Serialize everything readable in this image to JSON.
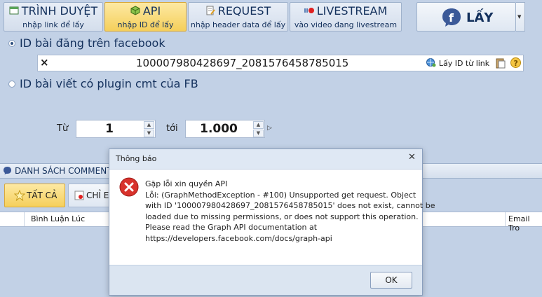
{
  "tabs": [
    {
      "title": "TRÌNH DUYỆT",
      "subtitle": "nhập link để lấy"
    },
    {
      "title": "API",
      "subtitle": "nhập ID để lấy"
    },
    {
      "title": "REQUEST",
      "subtitle": "nhập header data để lấy"
    },
    {
      "title": "LIVESTREAM",
      "subtitle": "vào video đang livestream"
    }
  ],
  "get_button": {
    "label": "LẤY",
    "icon": "facebook-chat-icon"
  },
  "options": {
    "post_id_label": "ID bài đăng trên facebook",
    "plugin_label": "ID bài viết có plugin cmt của FB"
  },
  "id_field": {
    "value": "100007980428697_2081576458785015",
    "get_id_label": "Lấy ID từ link"
  },
  "range": {
    "from_label": "Từ",
    "from_value": "1",
    "to_label": "tới",
    "to_value": "1.000"
  },
  "list_section": {
    "title": "DANH SÁCH COMMENT"
  },
  "filters": {
    "all_label": "TẤT CẢ",
    "only_label": "CHỈ EM"
  },
  "grid": {
    "col_time": "Bình Luận Lúc",
    "col_email": "Email Tro"
  },
  "dialog": {
    "title": "Thông báo",
    "lines": [
      "Gặp lỗi xin quyền API",
      "Lỗi: (GraphMethodException - #100) Unsupported get request. Object",
      "with ID '100007980428697_2081576458785015' does not exist, cannot be",
      "loaded due to missing permissions, or does not support this operation.",
      "Please read the Graph API documentation at",
      "https://developers.facebook.com/docs/graph-api"
    ],
    "ok_label": "OK"
  },
  "colors": {
    "background": "#c2d1e6",
    "active_tab": "#f5cf5b",
    "error_red": "#d8322c",
    "facebook_blue": "#3b5998"
  }
}
